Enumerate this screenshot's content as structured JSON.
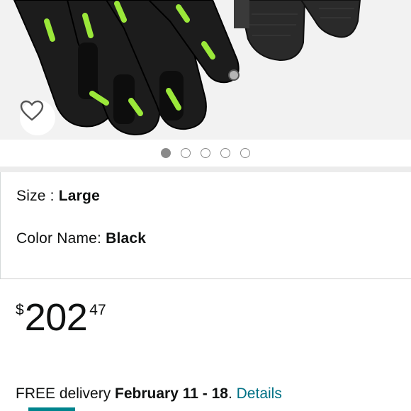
{
  "product": {
    "image_description_icon": "glove-product-image",
    "wishlist_icon": "heart-icon",
    "carousel": {
      "total": 5,
      "active_index": 0
    }
  },
  "variations": {
    "size_label": "Size : ",
    "size_value": "Large",
    "color_label": "Color Name: ",
    "color_value": "Black"
  },
  "price": {
    "symbol": "$",
    "whole": "202",
    "fraction": "47"
  },
  "delivery": {
    "prefix": "FREE delivery ",
    "date": "February 11 - 18",
    "suffix": ". ",
    "details_link": "Details"
  },
  "colors": {
    "link": "#007185",
    "accent_green": "#9be83a",
    "glove_black": "#1b1b1b"
  }
}
